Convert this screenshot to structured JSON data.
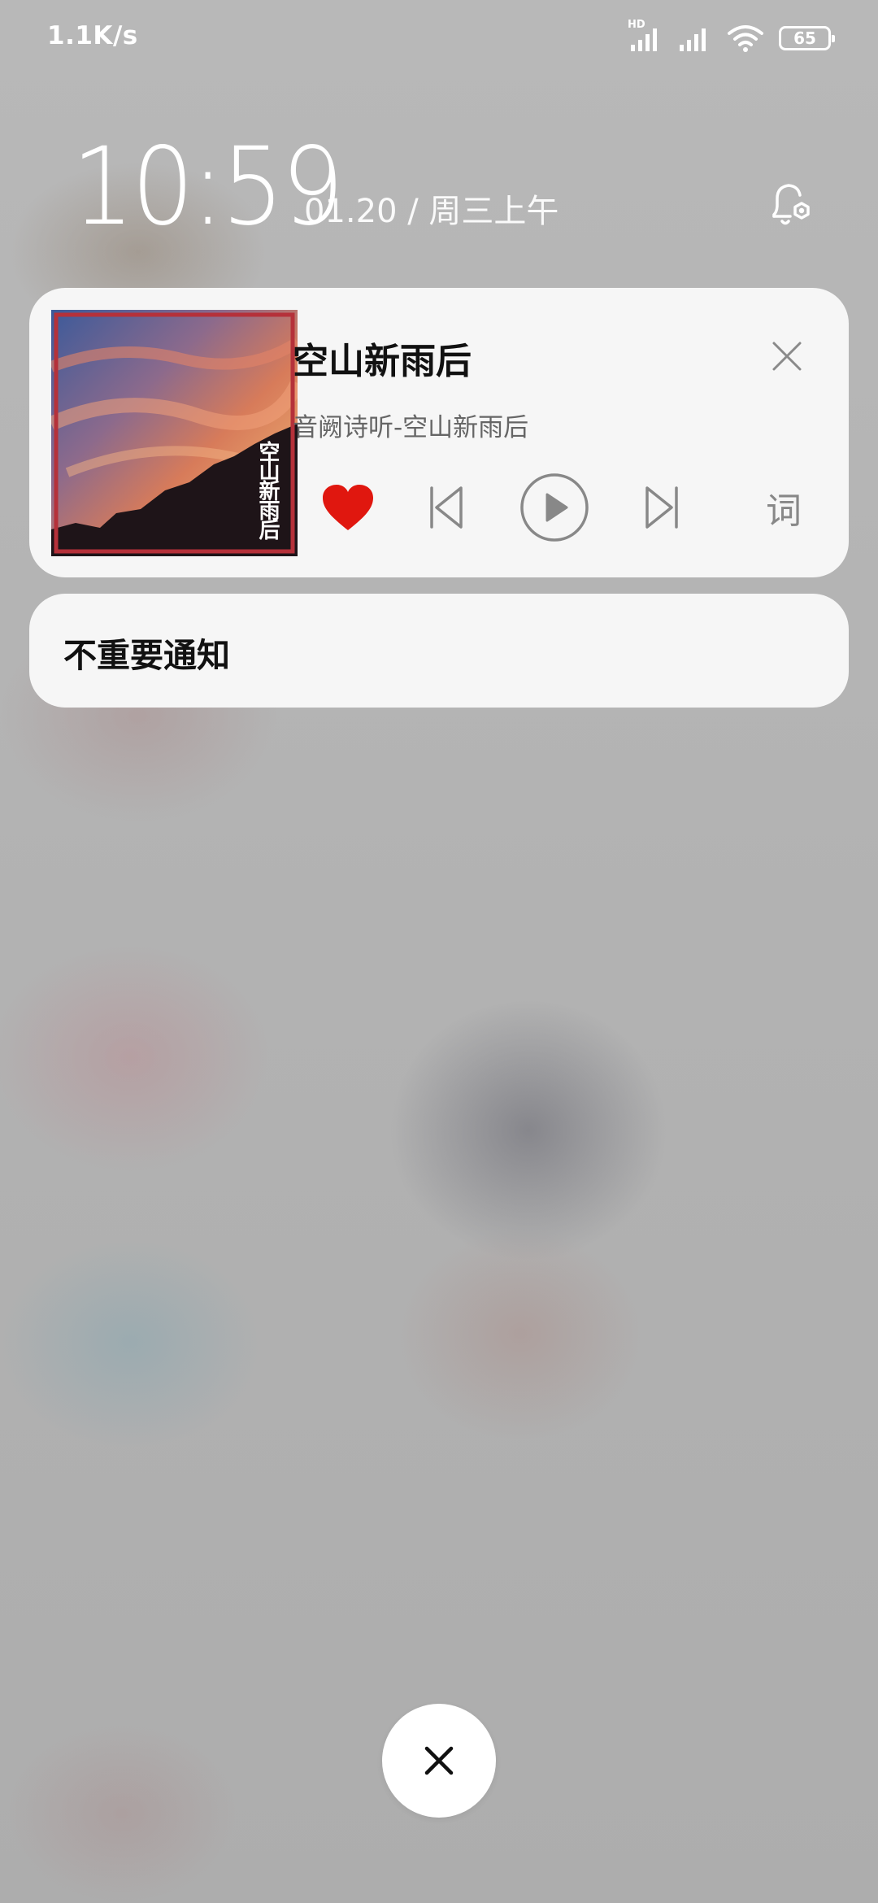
{
  "status_bar": {
    "net_speed": "1.1K/s",
    "hd_badge": "HD",
    "battery_level": "65",
    "icons": [
      "hd-signal-icon",
      "signal-icon",
      "wifi-icon",
      "battery-icon"
    ]
  },
  "clock": {
    "time": "10:59",
    "date": "01.20 / 周三上午",
    "bell_icon": "bell-settings-icon"
  },
  "music": {
    "title": "空山新雨后",
    "subtitle": "音阙诗听-空山新雨后",
    "album_art_text": "空山新雨后",
    "liked": true,
    "lyrics_label": "词",
    "accent_color": "#e0170f"
  },
  "notifications": {
    "section_label": "不重要通知"
  },
  "dismiss": {
    "icon": "close-icon"
  }
}
